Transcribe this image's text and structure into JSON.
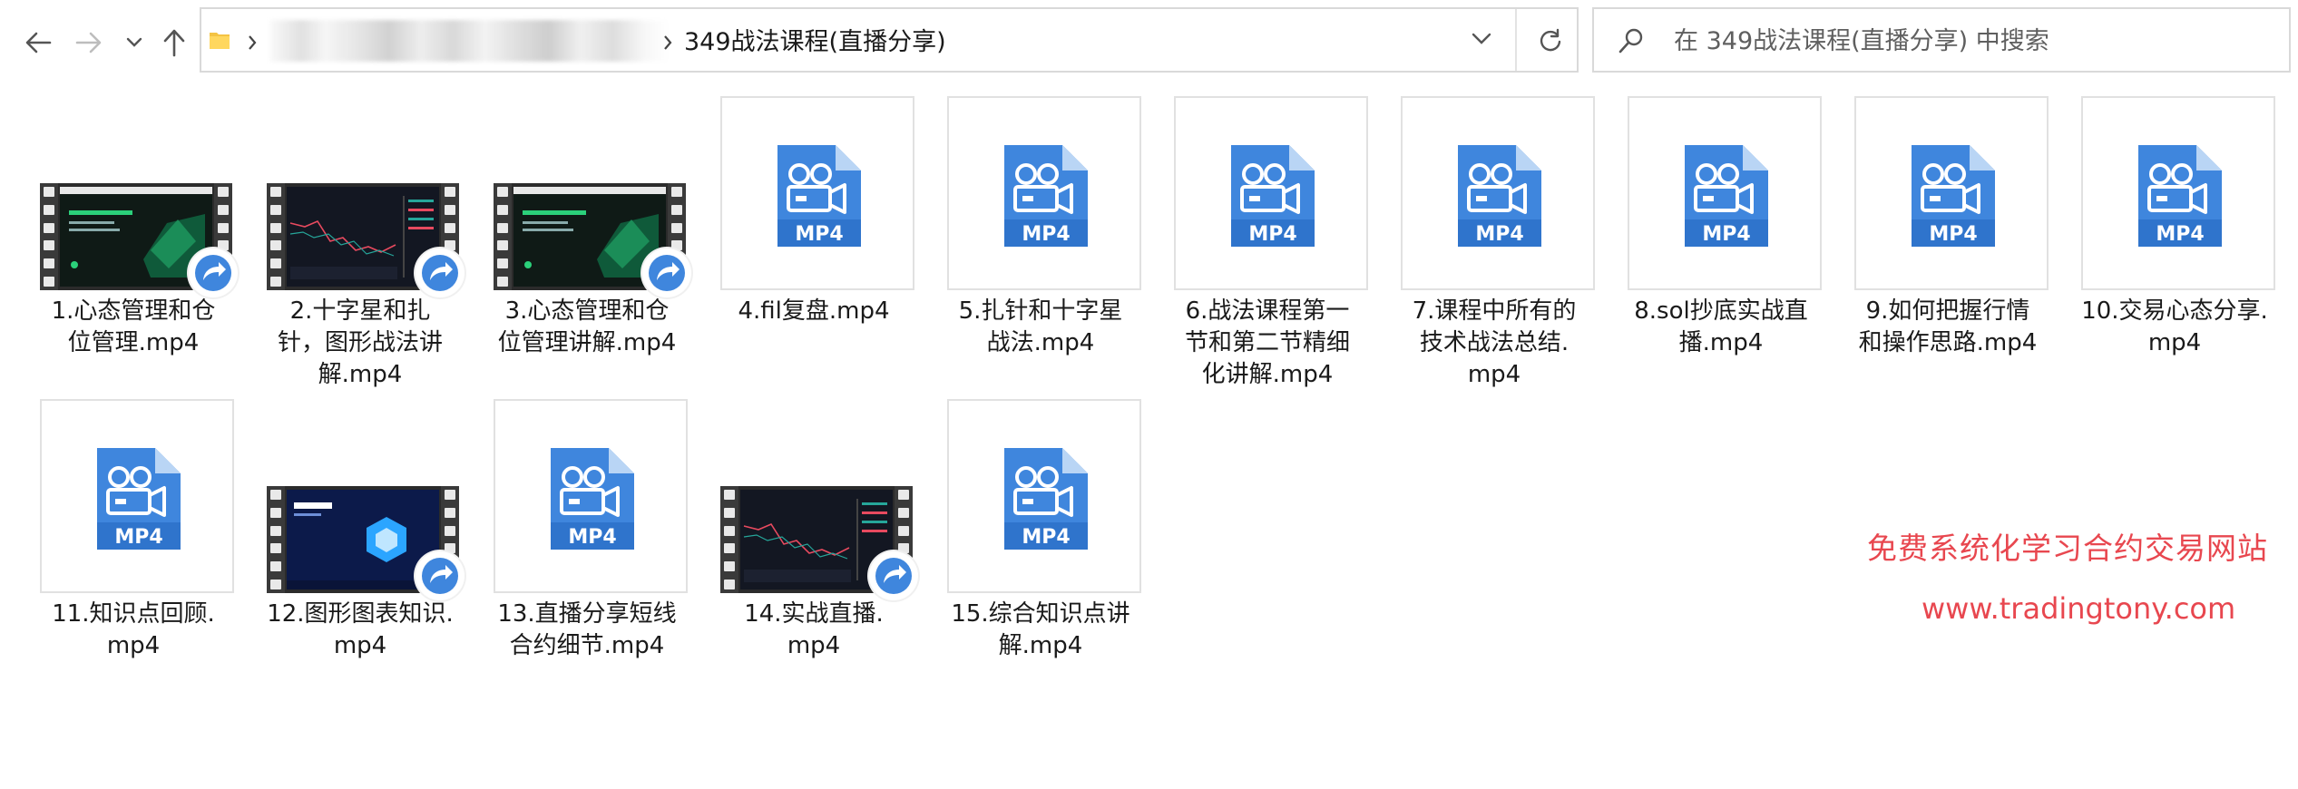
{
  "window": {
    "breadcrumb_current": "349战法课程(直播分享)",
    "search_placeholder": "在 349战法课程(直播分享) 中搜索"
  },
  "files": [
    {
      "lines": [
        "1.心态管理和仓",
        "位管理.mp4"
      ],
      "thumb": "video-slide-dark",
      "shared": true
    },
    {
      "lines": [
        "2.十字星和扎",
        "针，图形战法讲",
        "解.mp4"
      ],
      "thumb": "video-chart",
      "shared": true
    },
    {
      "lines": [
        "3.心态管理和仓",
        "位管理讲解.mp4"
      ],
      "thumb": "video-slide-dark",
      "shared": true
    },
    {
      "lines": [
        "4.fil复盘.mp4"
      ],
      "thumb": "mp4-doc",
      "shared": false
    },
    {
      "lines": [
        "5.扎针和十字星",
        "战法.mp4"
      ],
      "thumb": "mp4-doc",
      "shared": false
    },
    {
      "lines": [
        "6.战法课程第一",
        "节和第二节精细",
        "化讲解.mp4"
      ],
      "thumb": "mp4-doc",
      "shared": false
    },
    {
      "lines": [
        "7.课程中所有的",
        "技术战法总结.",
        "mp4"
      ],
      "thumb": "mp4-doc",
      "shared": false
    },
    {
      "lines": [
        "8.sol抄底实战直",
        "播.mp4"
      ],
      "thumb": "mp4-doc",
      "shared": false
    },
    {
      "lines": [
        "9.如何把握行情",
        "和操作思路.mp4"
      ],
      "thumb": "mp4-doc",
      "shared": false
    },
    {
      "lines": [
        "10.交易心态分享.",
        "mp4"
      ],
      "thumb": "mp4-doc",
      "shared": false
    },
    {
      "lines": [
        "11.知识点回顾.",
        "mp4"
      ],
      "thumb": "mp4-doc",
      "shared": false
    },
    {
      "lines": [
        "12.图形图表知识.",
        "mp4"
      ],
      "thumb": "video-slide-blue",
      "shared": true
    },
    {
      "lines": [
        "13.直播分享短线",
        "合约细节.mp4"
      ],
      "thumb": "mp4-doc",
      "shared": false
    },
    {
      "lines": [
        "14.实战直播.",
        "mp4"
      ],
      "thumb": "video-chart",
      "shared": true
    },
    {
      "lines": [
        "15.综合知识点讲",
        "解.mp4"
      ],
      "thumb": "mp4-doc",
      "shared": false
    }
  ],
  "doc_badge_text": "MP4",
  "watermark": {
    "line1": "免费系统化学习合约交易网站",
    "line2": "www.tradingtony.com"
  },
  "colors": {
    "mp4_blue": "#3f86dd",
    "watermark_red": "#e8474f",
    "folder_yellow": "#f4c343"
  }
}
